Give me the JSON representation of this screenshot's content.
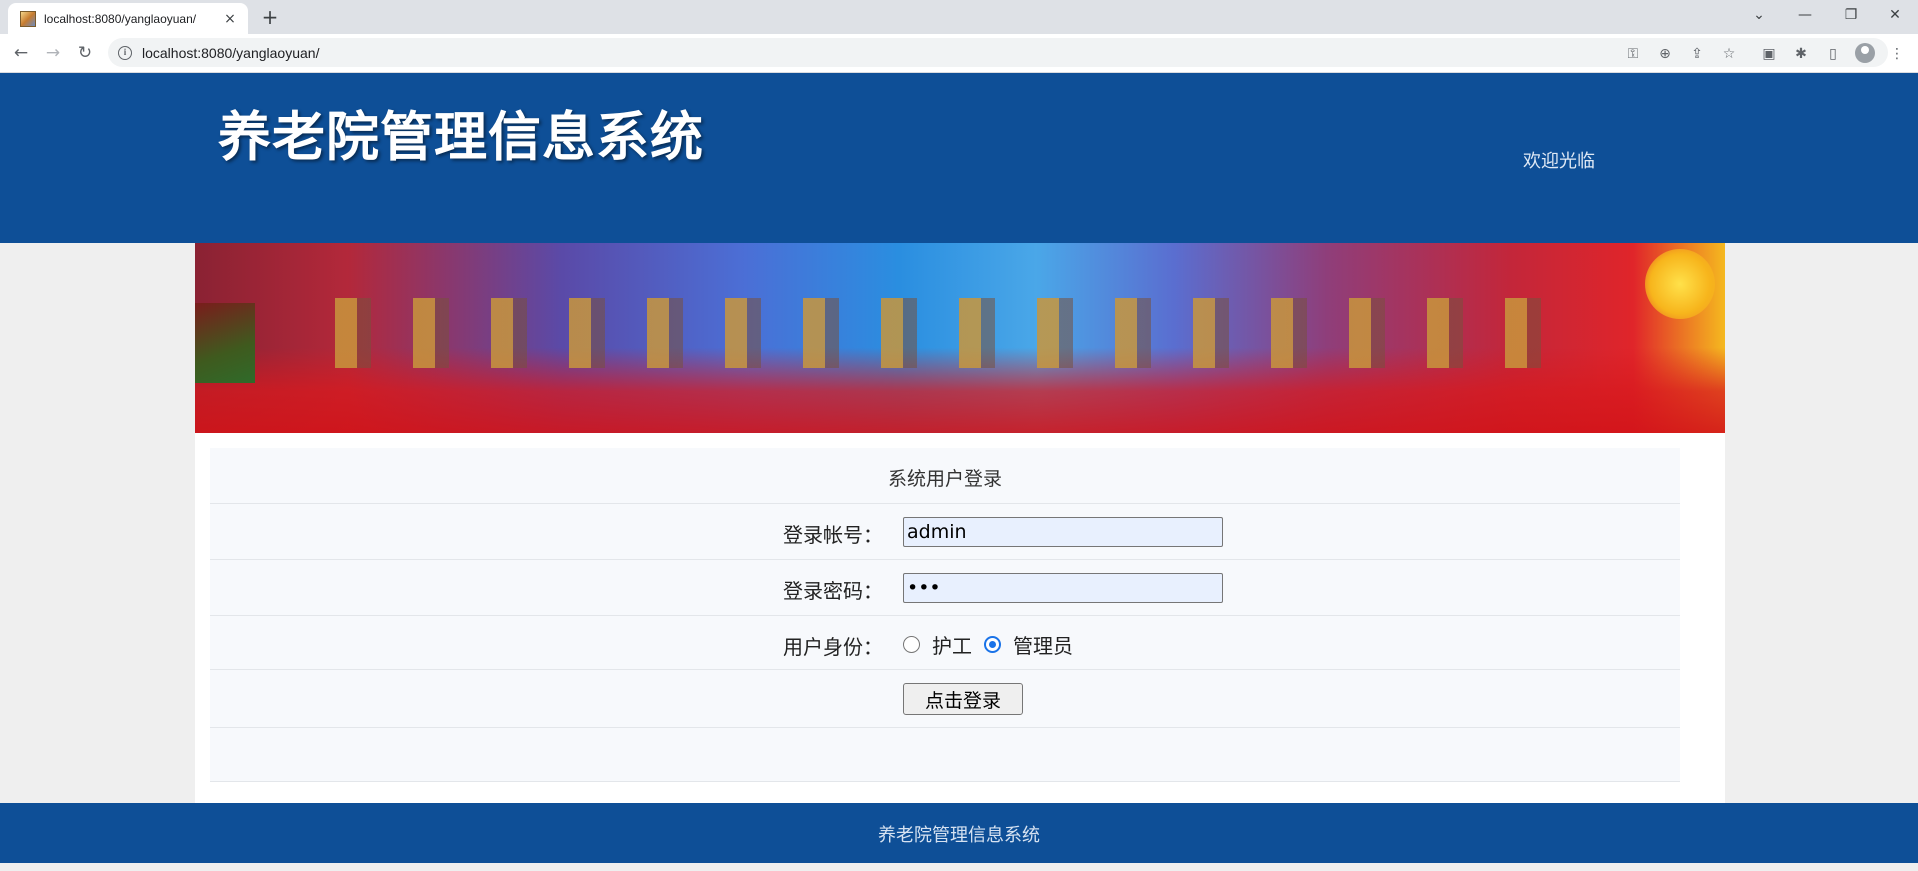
{
  "browser": {
    "tab_title": "localhost:8080/yanglaoyuan/",
    "tab_close": "×",
    "new_tab": "+",
    "url": "localhost:8080/yanglaoyuan/",
    "window_controls": {
      "dropdown": "⌄",
      "minimize": "—",
      "restore": "❐",
      "close": "✕"
    },
    "nav": {
      "back": "←",
      "forward": "→",
      "reload": "↻"
    },
    "toolbar_icons": {
      "key": "⚿",
      "zoom": "⊕",
      "share": "⇪",
      "bookmark": "☆",
      "extension_a": "▣",
      "extensions": "✱",
      "side_panel": "▯",
      "menu": "⋮"
    }
  },
  "header": {
    "site_title": "养老院管理信息系统",
    "welcome": "欢迎光临"
  },
  "banner": {
    "icon": "banner-image"
  },
  "login": {
    "title": "系统用户登录",
    "account_label": "登录帐号：",
    "account_value": "admin",
    "password_label": "登录密码：",
    "password_value": "•••",
    "role_label": "用户身份：",
    "role_options": [
      {
        "label": "护工",
        "checked": false
      },
      {
        "label": "管理员",
        "checked": true
      }
    ],
    "submit_label": "点击登录"
  },
  "footer": {
    "text": "养老院管理信息系统"
  },
  "colors": {
    "header_bg": "#0e4f97",
    "footer_bg": "#0e4f97",
    "input_bg": "#e8f0fe",
    "radio_accent": "#1a73e8"
  }
}
